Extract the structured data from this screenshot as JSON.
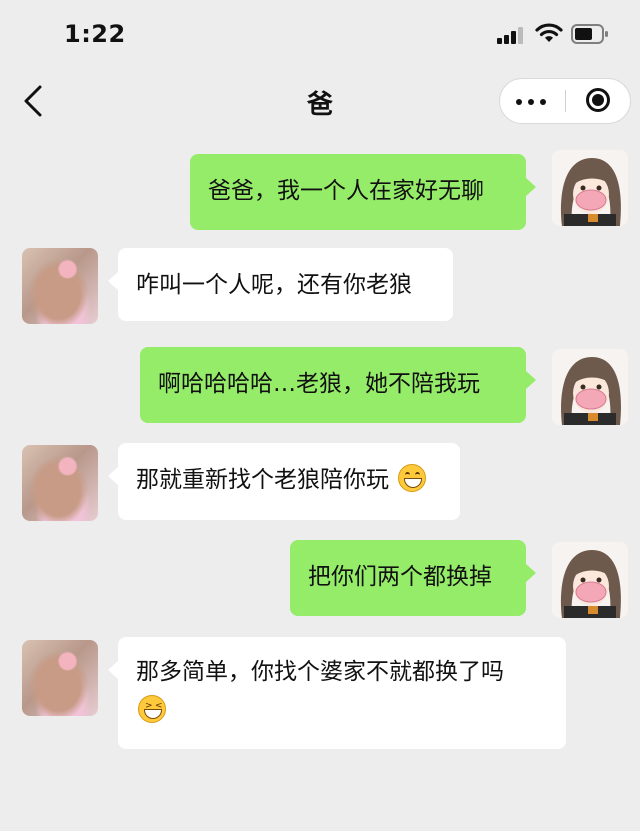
{
  "status_bar": {
    "time": "1:22"
  },
  "nav": {
    "title": "爸"
  },
  "messages": [
    {
      "side": "out",
      "text": "爸爸，我一个人在家好无聊"
    },
    {
      "side": "in",
      "text": "咋叫一个人呢，还有你老狼"
    },
    {
      "side": "out",
      "text": "啊哈哈哈哈…老狼，她不陪我玩"
    },
    {
      "side": "in",
      "text": "那就重新找个老狼陪你玩",
      "emoji": "grin-emoji"
    },
    {
      "side": "out",
      "text": "把你们两个都换掉"
    },
    {
      "side": "in",
      "text": "那多简单，你找个婆家不就都换了吗",
      "emoji": "laughing-squint-emoji"
    }
  ],
  "colors": {
    "background": "#ededed",
    "outgoing_bubble": "#95ec69",
    "incoming_bubble": "#ffffff"
  }
}
